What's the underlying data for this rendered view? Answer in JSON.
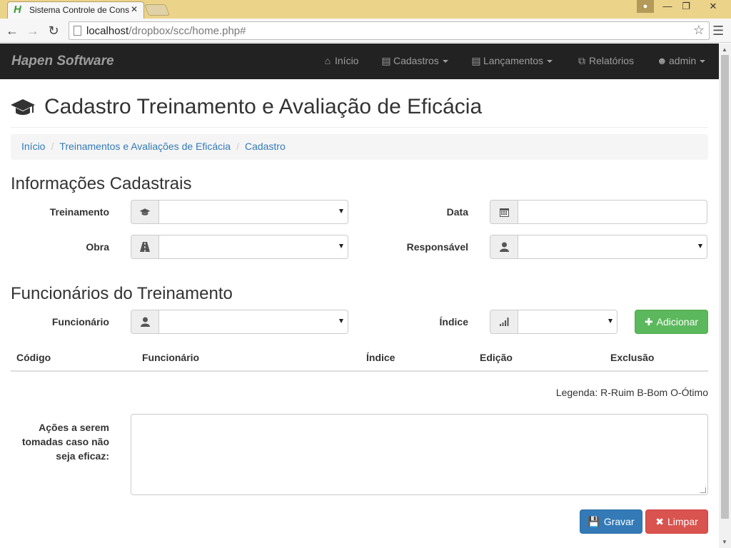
{
  "browser": {
    "tab_title": "Sistema Controle de Cons",
    "tab_icon_glyph": "H",
    "url_host": "localhost",
    "url_path": "/dropbox/scc/home.php#"
  },
  "navbar": {
    "brand": "Hapen Software",
    "items": [
      {
        "label": "Início",
        "icon": "home-icon"
      },
      {
        "label": "Cadastros",
        "icon": "list-icon"
      },
      {
        "label": "Lançamentos",
        "icon": "list-icon"
      },
      {
        "label": "Relatórios",
        "icon": "copy-icon"
      },
      {
        "label": "admin",
        "icon": "user-icon"
      }
    ]
  },
  "page": {
    "title": "Cadastro Treinamento e Avaliação de Eficácia",
    "breadcrumb": [
      "Início",
      "Treinamentos e Avaliações de Eficácia",
      "Cadastro"
    ]
  },
  "section_info": {
    "heading": "Informações Cadastrais",
    "treinamento_label": "Treinamento",
    "data_label": "Data",
    "obra_label": "Obra",
    "responsavel_label": "Responsável",
    "treinamento_value": "",
    "data_value": "",
    "obra_value": "",
    "responsavel_value": ""
  },
  "section_func": {
    "heading": "Funcionários do Treinamento",
    "funcionario_label": "Funcionário",
    "indice_label": "Índice",
    "add_button": "Adicionar",
    "funcionario_value": "",
    "indice_value": ""
  },
  "table": {
    "headers": [
      "Código",
      "Funcionário",
      "Índice",
      "Edição",
      "Exclusão"
    ],
    "rows": []
  },
  "legend": "Legenda: R-Ruim B-Bom O-Ótimo",
  "acoes": {
    "label_lines": [
      "Ações a serem",
      "tomadas caso não",
      "seja eficaz:"
    ],
    "value": ""
  },
  "actions": {
    "save": "Gravar",
    "clear": "Limpar"
  },
  "colors": {
    "navbar_bg": "#222222",
    "link": "#337ab7",
    "success": "#5cb85c",
    "primary": "#337ab7",
    "danger": "#d9534f"
  }
}
